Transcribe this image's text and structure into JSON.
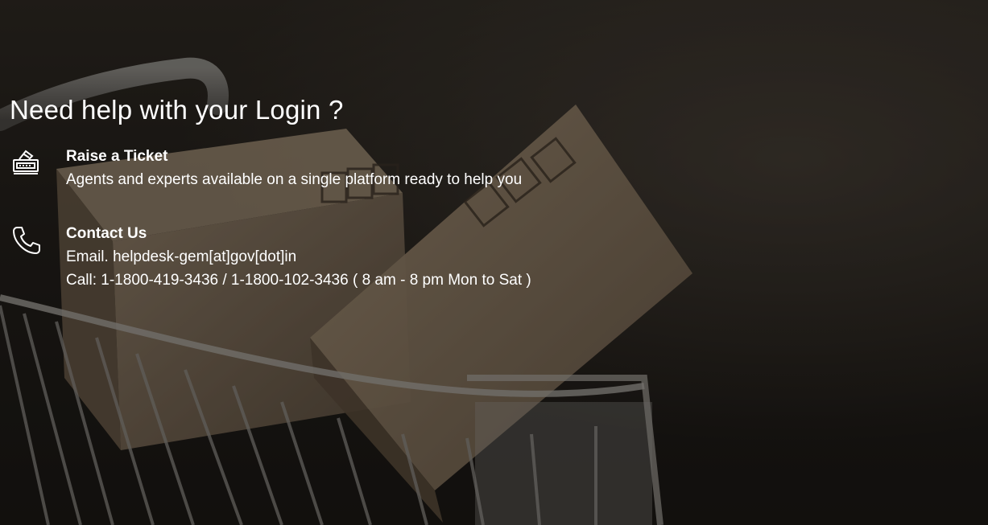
{
  "help": {
    "title": "Need help with your Login ?",
    "ticket": {
      "icon": "ticket-icon",
      "heading": "Raise a Ticket",
      "description": "Agents and experts available on a single platform ready to help you"
    },
    "contact": {
      "icon": "phone-icon",
      "heading": "Contact Us",
      "email": "Email. helpdesk-gem[at]gov[dot]in",
      "call": "Call: 1-1800-419-3436 / 1-1800-102-3436 ( 8 am - 8 pm Mon to Sat )"
    }
  },
  "colors": {
    "text": "#ffffff",
    "background": "#221e1a",
    "box": "#8a7660"
  }
}
